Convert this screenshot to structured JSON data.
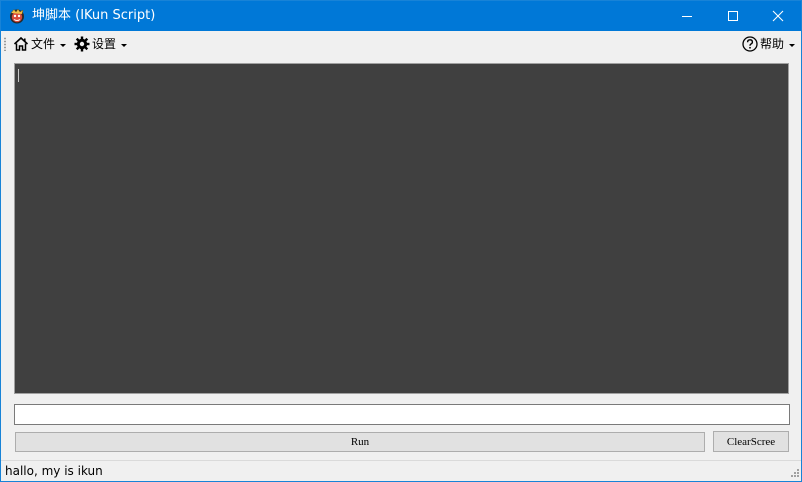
{
  "window": {
    "title": "坤脚本 (IKun Script)",
    "app_icon": "ikun-logo-icon",
    "accent_color": "#0078d7",
    "controls": [
      "minimize-icon",
      "maximize-icon",
      "close-icon"
    ]
  },
  "menubar": {
    "items": [
      {
        "label": "文件",
        "icon": "home-icon",
        "has_dropdown": true
      },
      {
        "label": "设置",
        "icon": "gear-icon",
        "has_dropdown": true
      },
      {
        "label": "帮助",
        "icon": "help-circle-icon",
        "has_dropdown": true
      }
    ]
  },
  "console": {
    "background": "#404040",
    "text": ""
  },
  "command_input": {
    "value": ""
  },
  "buttons": {
    "run_label": "Run",
    "clear_label": "ClearScree"
  },
  "status": {
    "text": "hallo, my is ikun"
  }
}
